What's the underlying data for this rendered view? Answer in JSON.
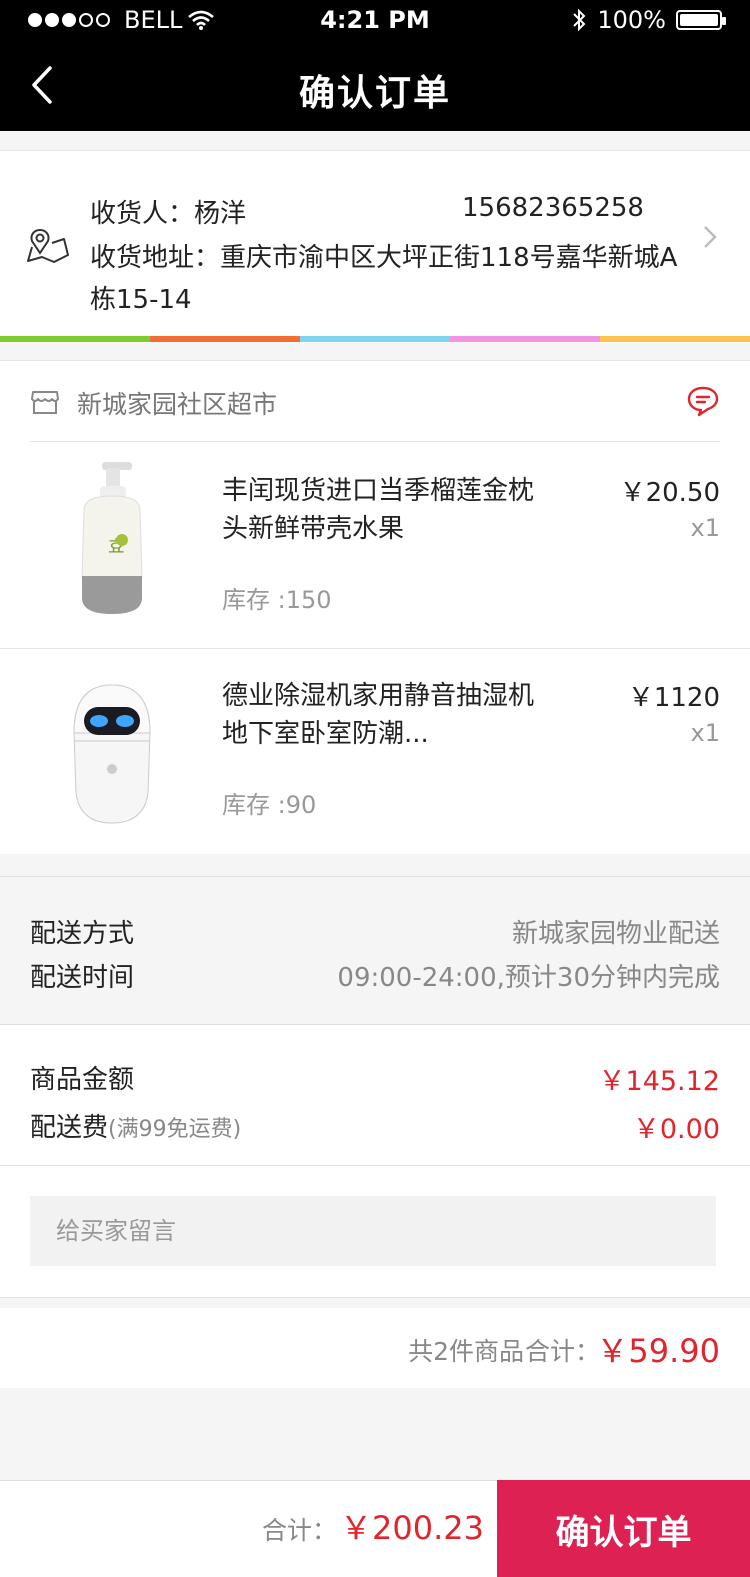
{
  "status_bar": {
    "carrier": "BELL",
    "time": "4:21 PM",
    "battery": "100%",
    "battery_level": 1.0
  },
  "nav": {
    "title": "确认订单"
  },
  "address": {
    "recipient": "收货人：杨洋",
    "phone": "15682365258",
    "address": "收货地址：重庆市渝中区大坪正街118号嘉华新城A栋15-14",
    "rainbow_colors": [
      "#7ccf2b",
      "#f36d34",
      "#7fd4f0",
      "#f294e3",
      "#ffc24a"
    ]
  },
  "store": {
    "name": "新城家园社区超市",
    "products": [
      {
        "name": "丰闰现货进口当季榴莲金枕头新鲜带壳水果",
        "price": "￥20.50",
        "qty": "x1",
        "stock": "库存 :150"
      },
      {
        "name": "德业除湿机家用静音抽湿机地下室卧室防潮...",
        "price": "￥1120",
        "qty": "x1",
        "stock": "库存 :90"
      }
    ]
  },
  "delivery": {
    "method_label": "配送方式",
    "method_value": "新城家园物业配送",
    "time_label": "配送时间",
    "time_value": "09:00-24:00,预计30分钟内完成"
  },
  "amounts": {
    "goods_label": "商品金额",
    "goods_value": "￥145.12",
    "fee_label": "配送费",
    "fee_note": "(满99免运费)",
    "fee_value": "￥0.00"
  },
  "message": {
    "placeholder": "给买家留言"
  },
  "summary": {
    "count": "共2件商品",
    "total_label": "合计：",
    "total_value": "￥59.90"
  },
  "bottom": {
    "total_label": "合计：",
    "total_value": "￥200.23",
    "confirm_label": "确认订单"
  },
  "colors": {
    "accent_red": "#e0262c",
    "confirm_button": "#dd2253",
    "header_bg": "#000000"
  }
}
